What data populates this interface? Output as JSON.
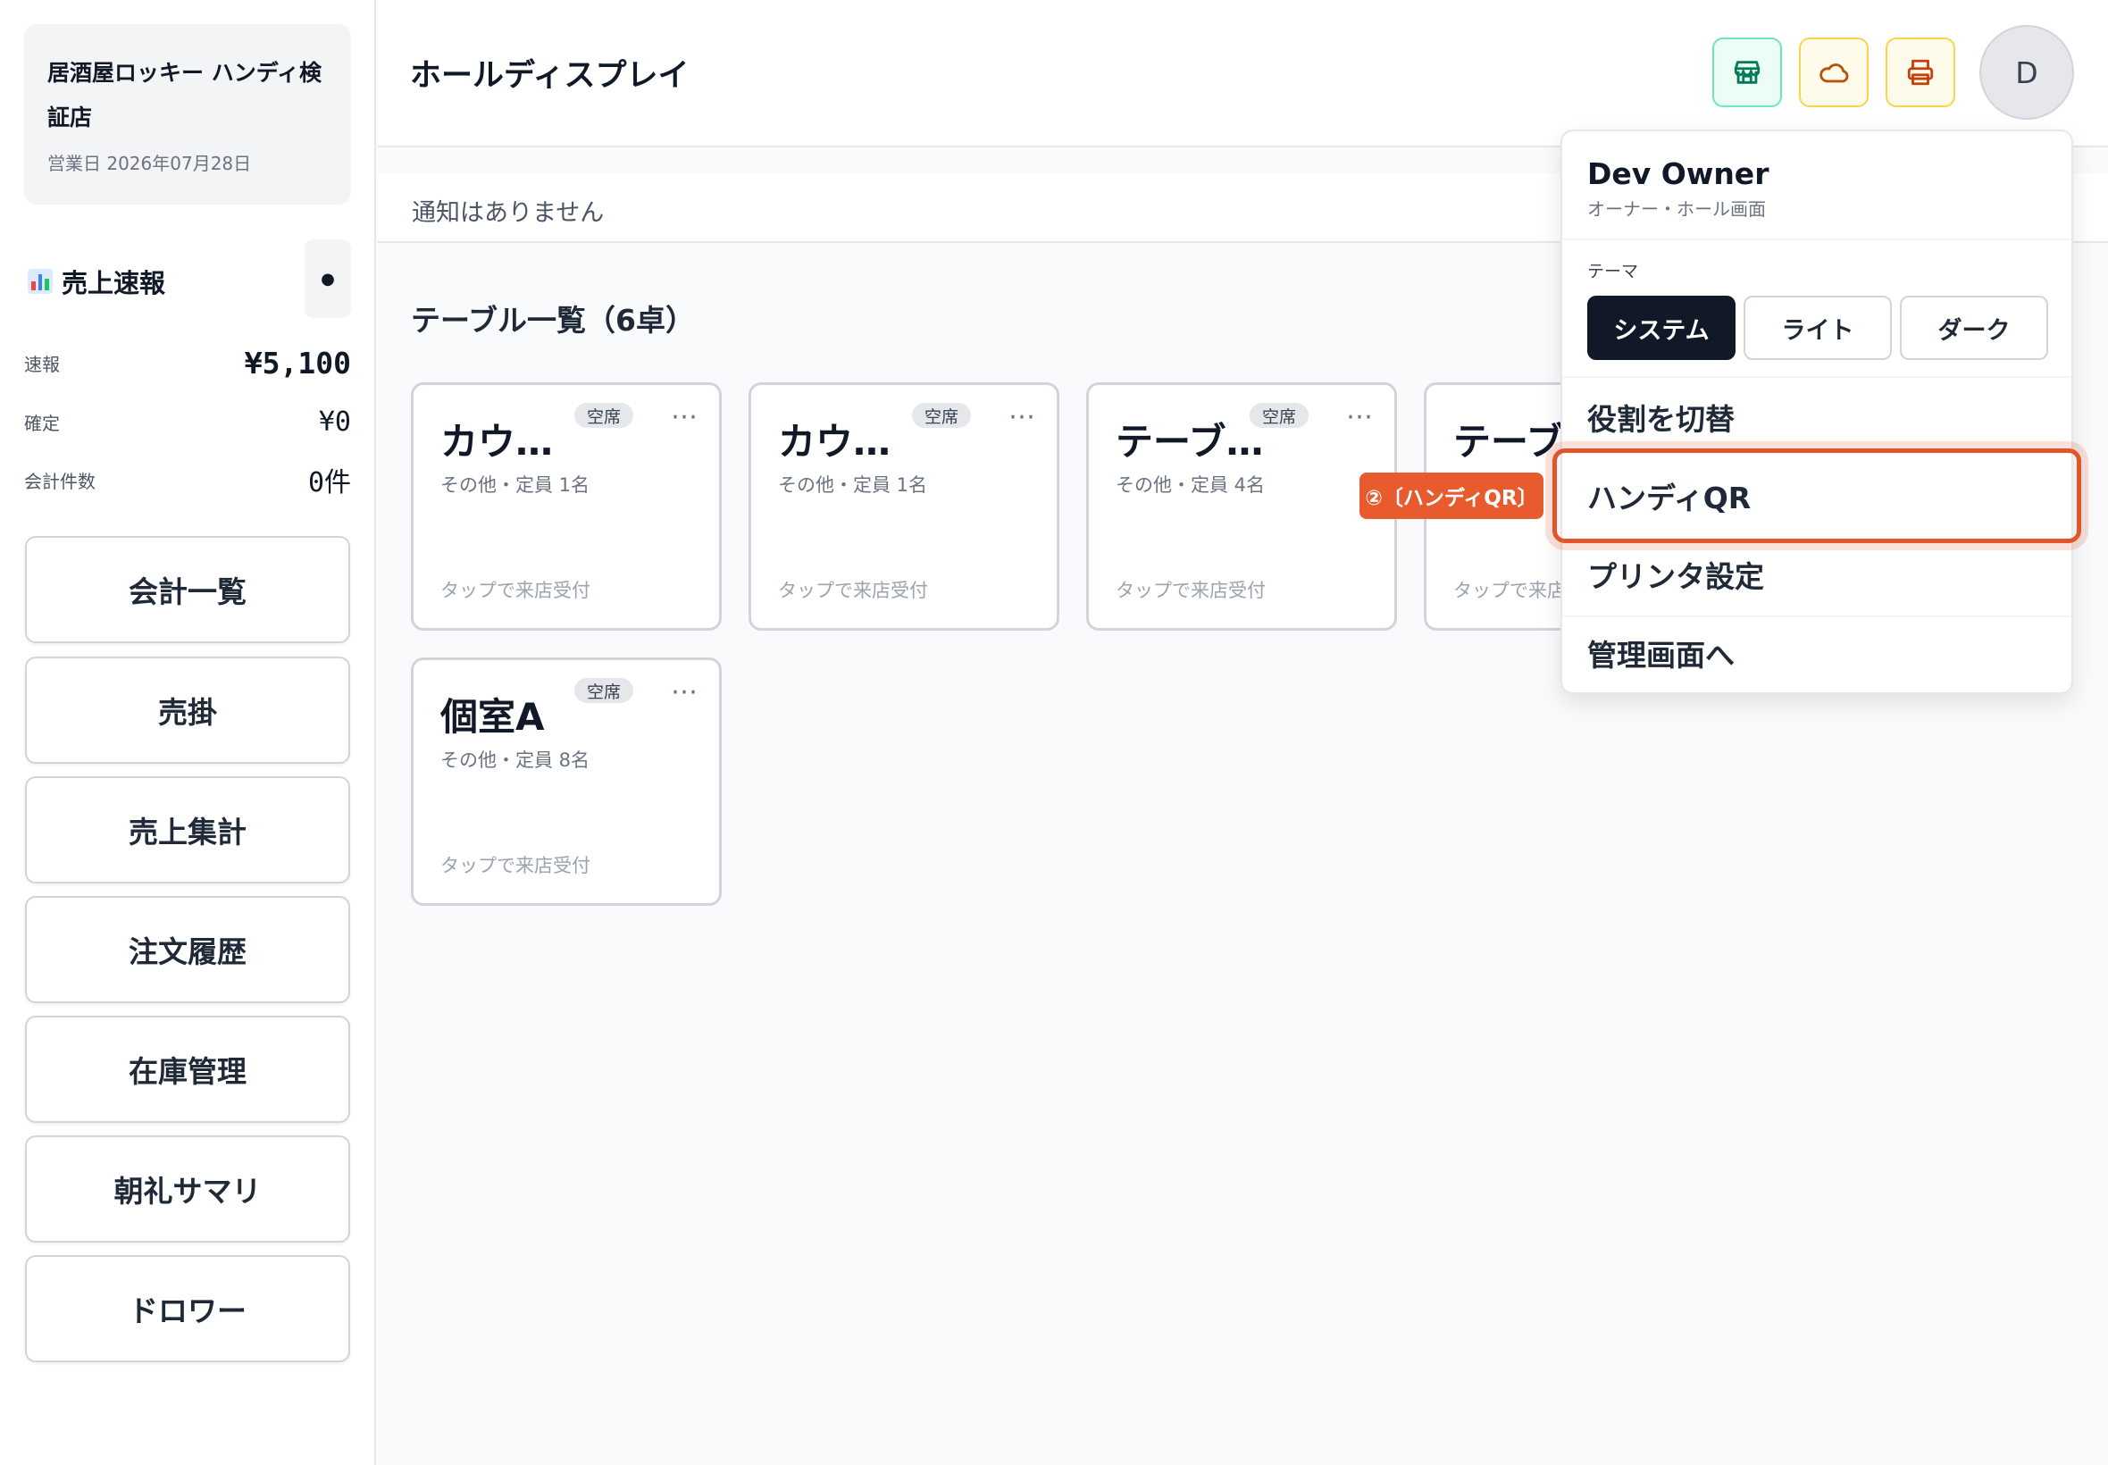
{
  "store": {
    "name": "居酒屋ロッキー ハンディ検証店",
    "business_day": "営業日 2026年07月28日"
  },
  "sales": {
    "title": "売上速報",
    "rows": [
      {
        "label": "速報",
        "value": "¥5,100"
      },
      {
        "label": "確定",
        "value": "¥0"
      },
      {
        "label": "会計件数",
        "value": "0件"
      }
    ]
  },
  "nav": [
    {
      "label": "会計一覧"
    },
    {
      "label": "売掛"
    },
    {
      "label": "売上集計"
    },
    {
      "label": "注文履歴"
    },
    {
      "label": "在庫管理"
    },
    {
      "label": "朝礼サマリ"
    },
    {
      "label": "ドロワー"
    }
  ],
  "header": {
    "title": "ホールディスプレイ",
    "avatar_initial": "D",
    "icons": [
      "store-icon",
      "cloud-icon",
      "printer-icon"
    ],
    "colors": {
      "store": "#047857",
      "cloud": "#b45309",
      "printer": "#c2410c"
    }
  },
  "notification": {
    "text": "通知はありません"
  },
  "tables": {
    "title": "テーブル一覧（6卓）",
    "items": [
      {
        "name": "カウ…",
        "status": "空席",
        "meta": "その他・定員 1名",
        "hint": "タップで来店受付"
      },
      {
        "name": "カウ…",
        "status": "空席",
        "meta": "その他・定員 1名",
        "hint": "タップで来店受付"
      },
      {
        "name": "テーブ…",
        "status": "空席",
        "meta": "その他・定員 4名",
        "hint": "タップで来店受付"
      },
      {
        "name": "テーブ…",
        "status": "",
        "meta": "",
        "hint": "タップで来店受"
      },
      {
        "name": "個室A",
        "status": "空席",
        "meta": "その他・定員 8名",
        "hint": "タップで来店受付"
      }
    ],
    "menu_glyph": "⋯"
  },
  "step_label": "②〔ハンディQR〕",
  "dropdown": {
    "user_name": "Dev Owner",
    "user_role": "オーナー・ホール画面",
    "theme_label": "テーマ",
    "theme_options": [
      "システム",
      "ライト",
      "ダーク"
    ],
    "theme_selected": "システム",
    "items": [
      "役割を切替",
      "ハンディQR",
      "プリンタ設定",
      "管理画面へ"
    ],
    "highlighted_item": "ハンディQR",
    "accent_color": "#e0552b"
  }
}
